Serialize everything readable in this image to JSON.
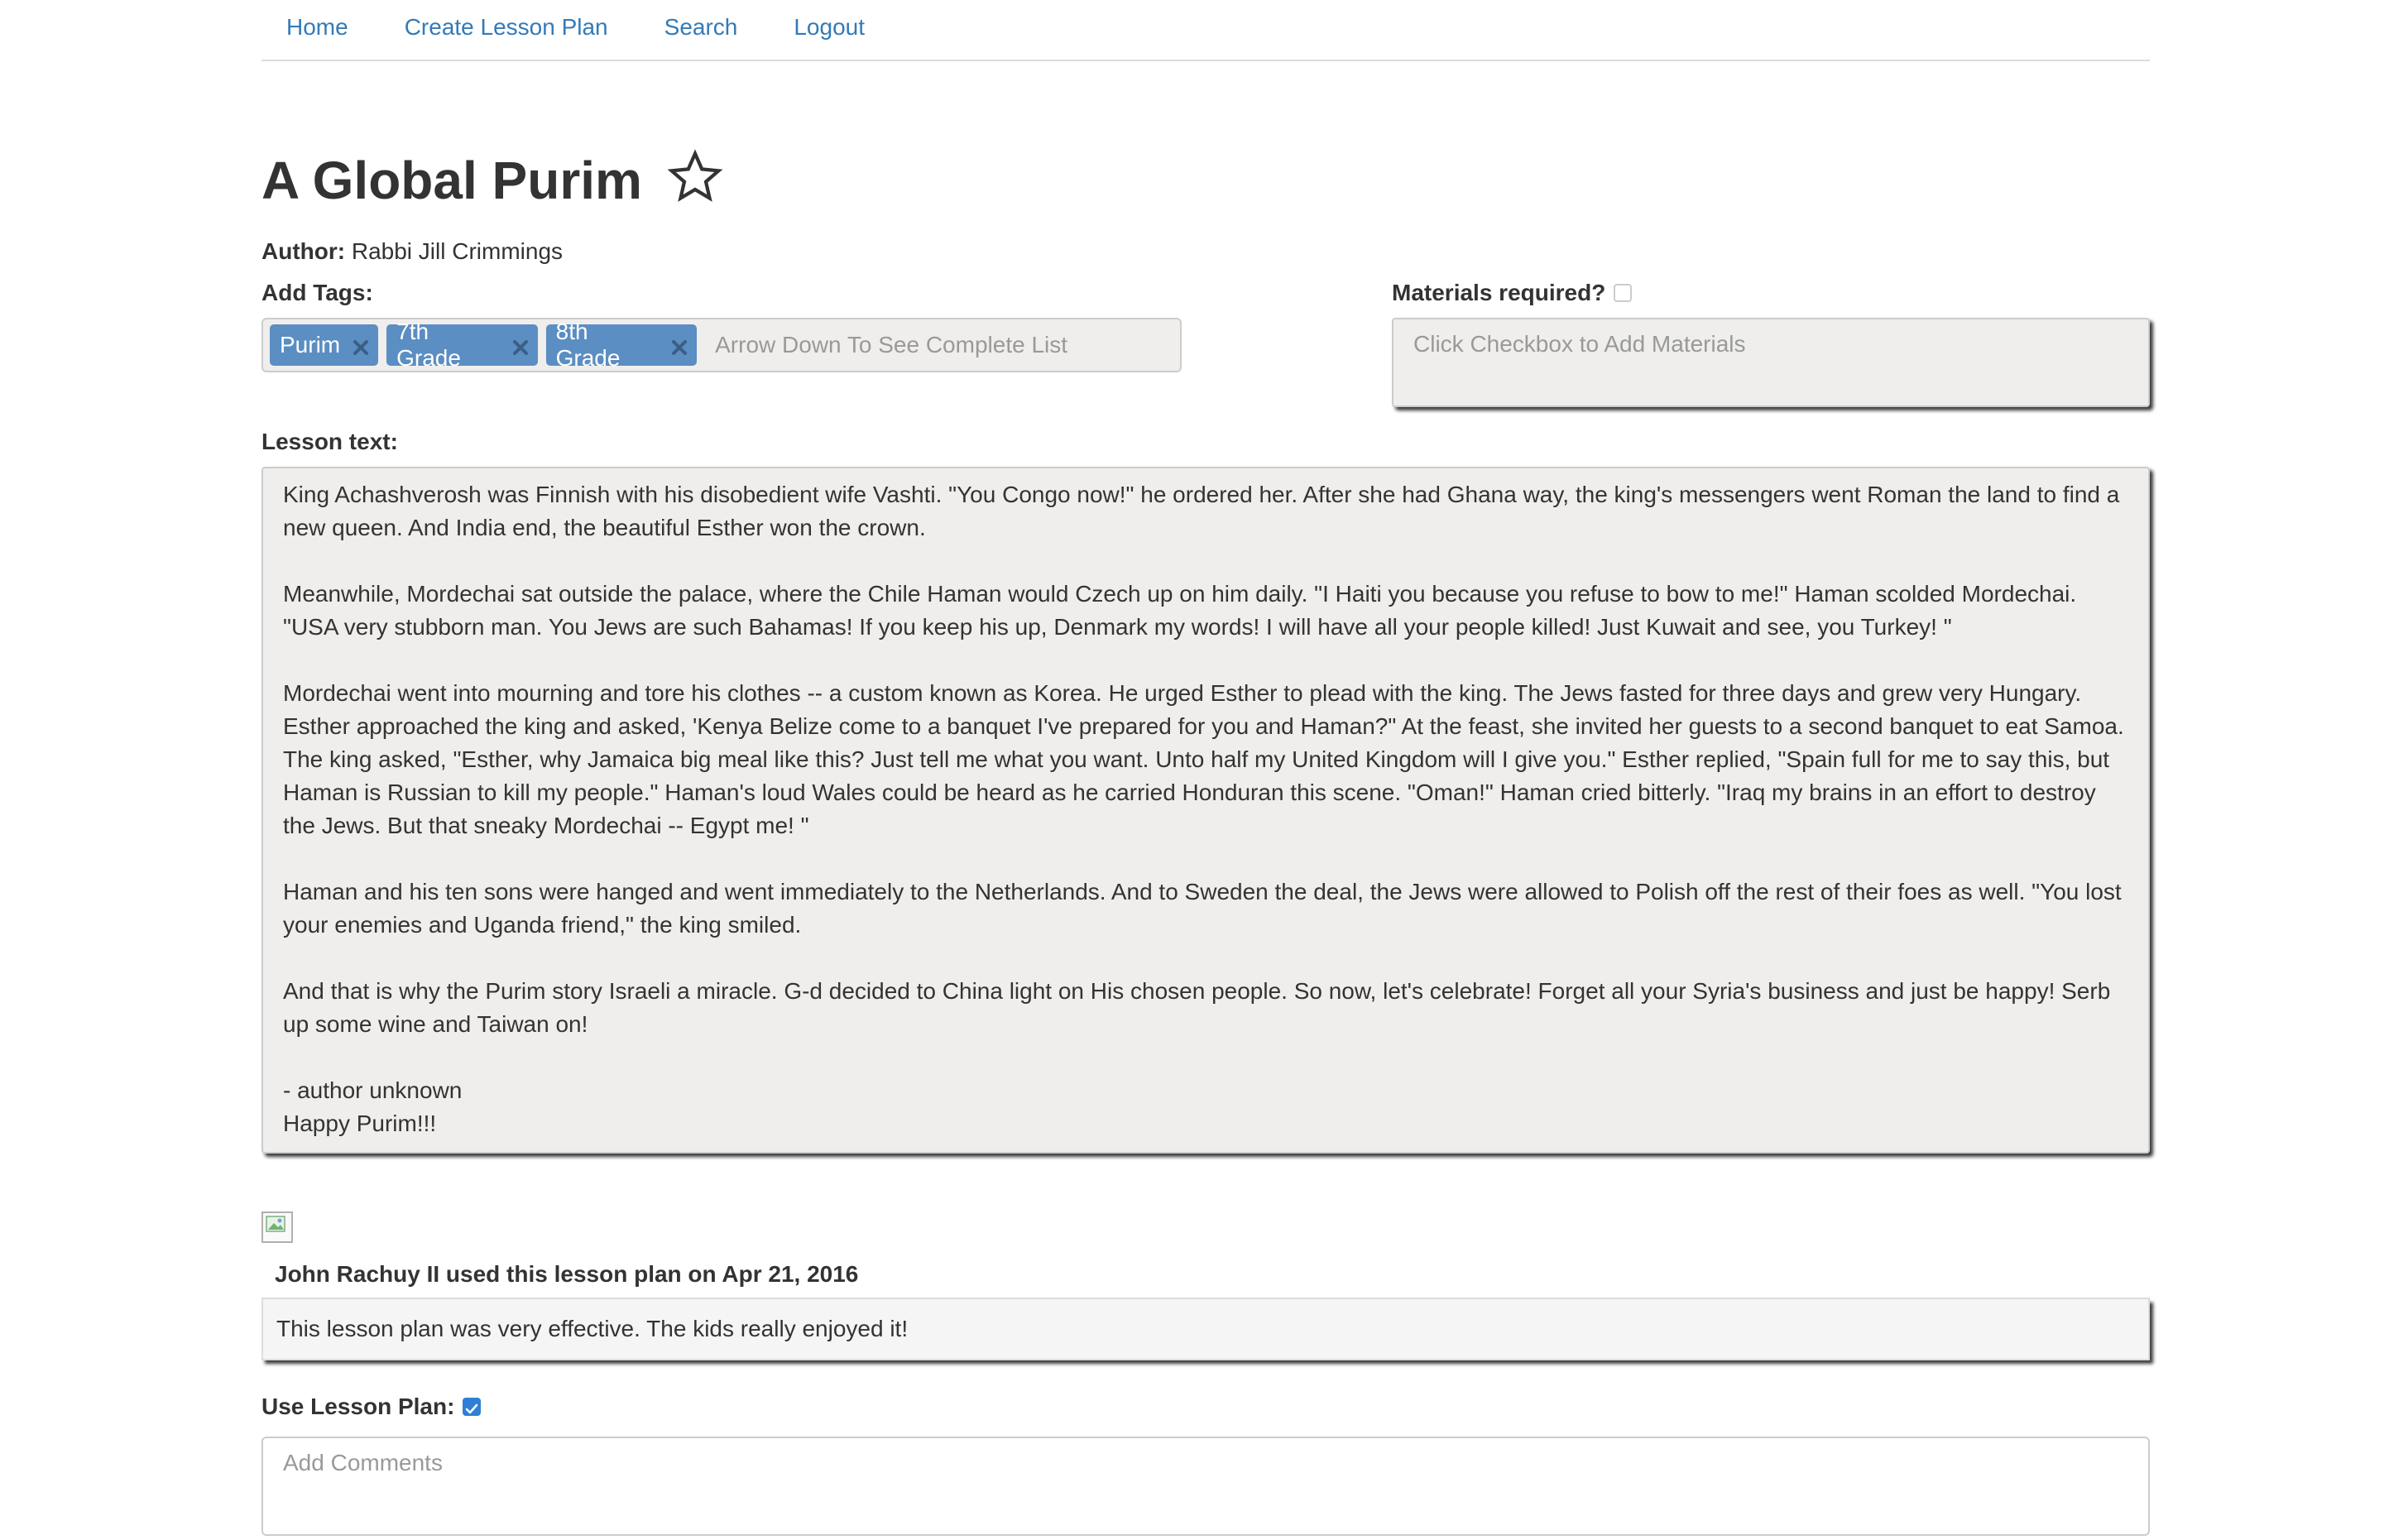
{
  "nav": {
    "items": [
      "Home",
      "Create Lesson Plan",
      "Search",
      "Logout"
    ]
  },
  "lesson": {
    "title": "A Global Purim",
    "author_label": "Author:",
    "author": "Rabbi Jill Crimmings"
  },
  "tags": {
    "label": "Add Tags:",
    "items": [
      "Purim",
      "7th Grade",
      "8th Grade"
    ],
    "placeholder": "Arrow Down To See Complete List"
  },
  "materials": {
    "label": "Materials required?",
    "placeholder": "Click Checkbox to Add Materials"
  },
  "lesson_text": {
    "label": "Lesson text:",
    "paragraphs": [
      "King Achashverosh was Finnish with his disobedient wife Vashti. \"You Congo now!\" he ordered her. After she had Ghana way, the king's messengers went Roman the land to find a new queen. And India end, the beautiful Esther won the crown.",
      "Meanwhile, Mordechai sat outside the palace, where the Chile Haman would Czech up on him daily. \"I Haiti you because you refuse to bow to me!\" Haman scolded Mordechai. \"USA very stubborn man. You Jews are such Bahamas! If you keep his up, Denmark my words! I will have all your people killed! Just Kuwait and see, you Turkey! \"",
      "Mordechai went into mourning and tore his clothes -- a custom known as Korea. He urged Esther to plead with the king. The Jews fasted for three days and grew very Hungary. Esther approached the king and asked, 'Kenya Belize come to a banquet I've prepared for you and Haman?\" At the feast, she invited her guests to a second banquet to eat Samoa. The king asked, \"Esther, why Jamaica big meal like this? Just tell me what you want. Unto half my United Kingdom will I give you.\" Esther replied, \"Spain full for me to say this, but Haman is Russian to kill my people.\" Haman's loud Wales could be heard as he carried Honduran this scene. \"Oman!\" Haman cried bitterly. \"Iraq my brains in an effort to destroy the Jews. But that sneaky Mordechai -- Egypt me! \"",
      "Haman and his ten sons were hanged and went immediately to the Netherlands. And to Sweden the deal, the Jews were allowed to Polish off the rest of their foes as well. \"You lost your enemies and Uganda friend,\" the king smiled.",
      "And that is why the Purim story Israeli a miracle. G-d decided to China light on His chosen people. So now, let's celebrate! Forget all your Syria's business and just be happy! Serb up some wine and Taiwan on!"
    ],
    "signoff_1": "- author unknown",
    "signoff_2": "Happy Purim!!!"
  },
  "usage": {
    "heading": "John Rachuy II used this lesson plan on Apr 21, 2016",
    "comment": "This lesson plan was very effective. The kids really enjoyed it!"
  },
  "use_plan": {
    "label": "Use Lesson Plan:",
    "checked": true,
    "comments_placeholder": "Add Comments"
  },
  "colors": {
    "link": "#337ab7",
    "tag": "#5b8ec2",
    "checkbox": "#2f7fd6"
  }
}
